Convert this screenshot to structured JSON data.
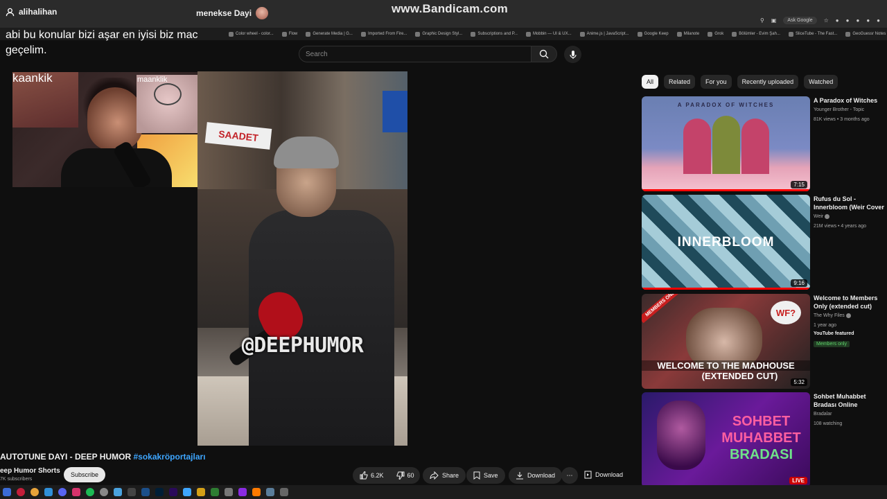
{
  "overlay": {
    "streamer_left": "alihalihan",
    "streamer_right": "menekse Dayi",
    "watermark": "www.Bandicam.com",
    "chat_message": "abi bu konular bizi aşar en iyisi biz mac geçelim.",
    "webcam_label": "kaankik",
    "pip_label": "maanklik"
  },
  "browser": {
    "ask_google": "Ask Google",
    "bookmarks": [
      "Color wheel - color...",
      "Flow",
      "Generate Media | G...",
      "Imported From Fire...",
      "Graphic Design Styl...",
      "Subscriptions and P...",
      "Mobbin — UI & UX...",
      "Anime.js | JavaScript...",
      "Google Keep",
      "Milanote",
      "Grok",
      "Bölümler - Evim Şah...",
      "SliceTube - The Fast...",
      "GeoGuessr Notes"
    ]
  },
  "search": {
    "placeholder": "Search"
  },
  "video": {
    "caption": "@DEEPHUMOR",
    "sign_text": "SAADET",
    "title_main": "AUTOTUNE DAYI - DEEP HUMOR ",
    "title_hashtag": "#sokakröportajları",
    "channel": "eep Humor Shorts",
    "subscribers": "7K subscribers",
    "subscribe_label": "Subscribe"
  },
  "actions": {
    "likes": "6.2K",
    "dislikes": "60",
    "share": "Share",
    "save": "Save",
    "download": "Download",
    "download2": "Download"
  },
  "chips": [
    {
      "label": "All",
      "active": true
    },
    {
      "label": "Related",
      "active": false
    },
    {
      "label": "For you",
      "active": false
    },
    {
      "label": "Recently uploaded",
      "active": false
    },
    {
      "label": "Watched",
      "active": false
    }
  ],
  "recommendations": [
    {
      "title": "A Paradox of Witches",
      "channel": "Younger Brother - Topic",
      "meta": "81K views • 3 months ago",
      "duration": "7:15",
      "thumb_text": "A PARADOX OF WITCHES"
    },
    {
      "title": "Rufus du Sol - Innerbloom (Weir Cover ft. Tanner Frui...",
      "channel": "Weir",
      "meta": "21M views • 4 years ago",
      "duration": "9:16",
      "thumb_text": "INNERBLOOM"
    },
    {
      "title": "Welcome to Members Only (extended cut)",
      "channel": "The Why Files",
      "meta": "1 year ago",
      "badge": "YouTube featured",
      "members": "Members only",
      "duration": "5:32",
      "thumb_text_1": "WELCOME TO THE MADHOUSE",
      "thumb_text_2": "(EXTENDED CUT)",
      "thumb_corner": "MEMBERS ONLY",
      "thumb_wf": "WF?"
    },
    {
      "title": "Sohbet Muhabbet Bradası Online",
      "channel": "Bradalar",
      "meta": "108 watching",
      "live": "LIVE",
      "thumb_text_1": "SOHBET",
      "thumb_text_2": "MUHABBET",
      "thumb_text_3": "BRADASI"
    }
  ]
}
